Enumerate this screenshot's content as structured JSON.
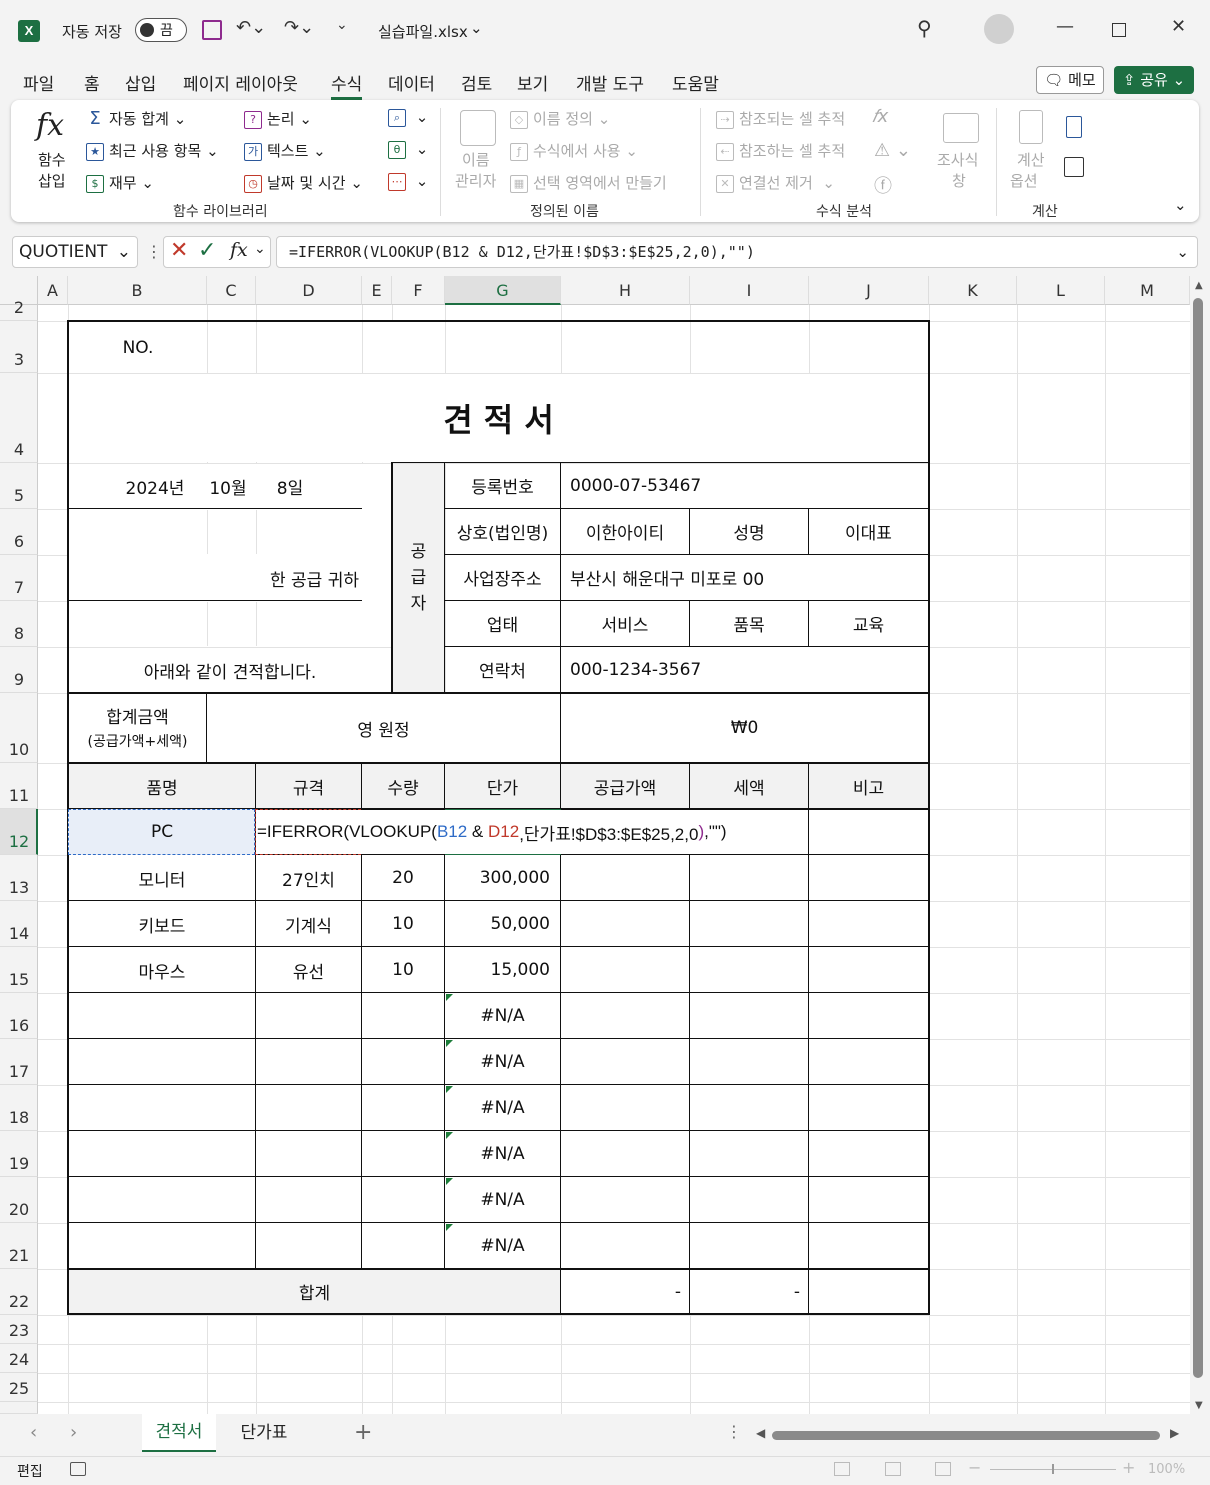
{
  "titlebar": {
    "autosave_label": "자동 저장",
    "autosave_state": "끔",
    "filename": "실습파일.xlsx"
  },
  "menu": {
    "tabs": [
      "파일",
      "홈",
      "삽입",
      "페이지 레이아웃",
      "수식",
      "데이터",
      "검토",
      "보기",
      "개발 도구",
      "도움말"
    ],
    "active": "수식",
    "memo_label": "메모",
    "share_label": "공유"
  },
  "ribbon": {
    "insert_function": "함수\n삽입",
    "insert_function_l1": "함수",
    "insert_function_l2": "삽입",
    "autosum": "자동 합계",
    "recent": "최근 사용 항목",
    "financial": "재무",
    "logical": "논리",
    "text": "텍스트",
    "datetime": "날짜 및 시간",
    "group_library": "함수 라이브러리",
    "name_manager_l1": "이름",
    "name_manager_l2": "관리자",
    "define_name": "이름 정의",
    "use_in_formula": "수식에서 사용",
    "create_from_selection": "선택 영역에서 만들기",
    "group_defined_names": "정의된 이름",
    "trace_precedents": "참조되는 셀 추적",
    "trace_dependents": "참조하는 셀 추적",
    "remove_arrows": "연결선 제거",
    "watch_window_l1": "조사식",
    "watch_window_l2": "창",
    "group_auditing": "수식 분석",
    "calc_options_l1": "계산",
    "calc_options_l2": "옵션",
    "group_calculation": "계산"
  },
  "formula_bar": {
    "name_box": "QUOTIENT",
    "formula": "=IFERROR(VLOOKUP(B12 & D12,단가표!$D$3:$E$25,2,0),\"\")"
  },
  "columns": [
    "A",
    "B",
    "C",
    "D",
    "E",
    "F",
    "G",
    "H",
    "I",
    "J",
    "K",
    "L",
    "M"
  ],
  "rows": [
    "2",
    "3",
    "4",
    "5",
    "6",
    "7",
    "8",
    "9",
    "10",
    "11",
    "12",
    "13",
    "14",
    "15",
    "16",
    "17",
    "18",
    "19",
    "20",
    "21",
    "22",
    "23",
    "24",
    "25"
  ],
  "sheet": {
    "no_label": "NO.",
    "title": "견 적 서",
    "date_year": "2024년",
    "date_month": "10월",
    "date_day": "8일",
    "recipient": "한 공급 귀하",
    "greeting": "아래와 같이 견적합니다.",
    "supplier_vertical_1": "공",
    "supplier_vertical_2": "급",
    "supplier_vertical_3": "자",
    "reg_no_label": "등록번호",
    "reg_no": "0000-07-53467",
    "company_label": "상호(법인명)",
    "company": "이한아이티",
    "rep_label": "성명",
    "rep": "이대표",
    "address_label": "사업장주소",
    "address": "부산시 해운대구 미포로 00",
    "biz_type_label": "업태",
    "biz_type": "서비스",
    "item_label": "품목",
    "item": "교육",
    "contact_label": "연락처",
    "contact": "000-1234-3567",
    "total_label_1": "합계금액",
    "total_label_2": "(공급가액+세액)",
    "total_korean": "영 원정",
    "total_amount": "₩0",
    "headers": [
      "품명",
      "규격",
      "수량",
      "단가",
      "공급가액",
      "세액",
      "비고"
    ],
    "row12_name": "PC",
    "editing_formula_prefix": "=IFERROR(VLOOKUP(",
    "editing_ref1": "B12",
    "editing_amp": " & ",
    "editing_ref2": "D12",
    "editing_suffix_a": ",단가표!$D$3:$E$25,2,0",
    "editing_paren": ")",
    "editing_suffix_b": ",\"\")",
    "items": [
      {
        "name": "모니터",
        "spec": "27인치",
        "qty": "20",
        "price": "300,000"
      },
      {
        "name": "키보드",
        "spec": "기계식",
        "qty": "10",
        "price": "50,000"
      },
      {
        "name": "마우스",
        "spec": "유선",
        "qty": "10",
        "price": "15,000"
      }
    ],
    "na_values": [
      "#N/A",
      "#N/A",
      "#N/A",
      "#N/A",
      "#N/A",
      "#N/A"
    ],
    "sum_label": "합계",
    "sum_supply": "-",
    "sum_tax": "-"
  },
  "sheet_tabs": {
    "tabs": [
      "견적서",
      "단가표"
    ],
    "active": "견적서",
    "add": "+"
  },
  "status": {
    "mode": "편집",
    "zoom": "100%"
  },
  "colors": {
    "accent": "#1d6f42",
    "ref_blue": "#2e6bc7",
    "ref_red": "#c0392b",
    "select_fill": "#e8eef8"
  }
}
